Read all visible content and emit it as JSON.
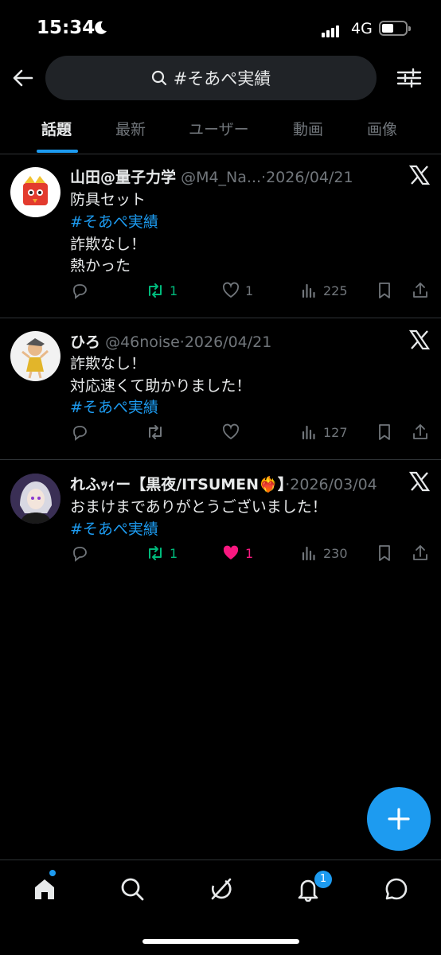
{
  "status_bar": {
    "time": "15:34",
    "network": "4G",
    "icons": [
      "moon-icon",
      "signal-icon",
      "battery-icon"
    ]
  },
  "header": {
    "search_query": "#そあぺ実績",
    "icons": [
      "back-arrow-icon",
      "search-icon",
      "filter-icon"
    ]
  },
  "tabs": [
    {
      "label": "話題",
      "active": true
    },
    {
      "label": "最新",
      "active": false
    },
    {
      "label": "ユーザー",
      "active": false
    },
    {
      "label": "動画",
      "active": false
    },
    {
      "label": "画像",
      "active": false
    }
  ],
  "posts": [
    {
      "name": "山田@量子力学",
      "handle": "@M4_Na...",
      "sep": "·",
      "date": "2026/04/21",
      "lines": [
        "防具セット",
        "#そあぺ実績",
        "詐欺なし！",
        "熱かった"
      ],
      "actions": {
        "replies": "",
        "retweets": "1",
        "likes": "1",
        "views": "225"
      },
      "retweeted": true,
      "liked": false
    },
    {
      "name": "ひろ",
      "handle": "@46noise",
      "sep": "·",
      "date": "2026/04/21",
      "lines": [
        "詐欺なし！",
        "対応速くて助かりました！",
        "#そあぺ実績"
      ],
      "actions": {
        "replies": "",
        "retweets": "",
        "likes": "",
        "views": "127"
      },
      "retweeted": false,
      "liked": false
    },
    {
      "name": "れふｯｨー【黒夜/ITSUMEN❤️‍🔥】",
      "handle": "",
      "sep": "·",
      "date": "2026/03/04",
      "lines": [
        "おまけまでありがとうございました！",
        " #そあぺ実績"
      ],
      "actions": {
        "replies": "",
        "retweets": "1",
        "likes": "1",
        "views": "230"
      },
      "retweeted": true,
      "liked": true
    }
  ],
  "bottom_nav": {
    "items": [
      "home-icon",
      "search-icon",
      "grok-icon",
      "notifications-icon",
      "messages-icon"
    ],
    "notification_badge": "1"
  },
  "colors": {
    "accent": "#1d9bf0",
    "retweet": "#00ba7c",
    "like": "#f91880",
    "muted": "#71767b",
    "text": "#e7e9ea",
    "background": "#000000"
  }
}
